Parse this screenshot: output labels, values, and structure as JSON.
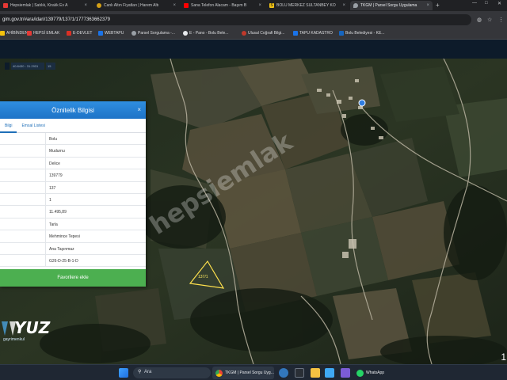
{
  "browser": {
    "tabs": [
      {
        "label": "Hepsiemlak | Satılık, Kiralık Ev A",
        "icon_color": "#e53935"
      },
      {
        "label": "Canlı Altın Fiyatları | Harem Altı",
        "icon_color": "#d4a017"
      },
      {
        "label": "Sana Telefon Alacam - Başım B",
        "icon_color": "#ff0000"
      },
      {
        "label": "BOLU MERKEZ SULTANBEY KÖ",
        "icon_color": "#f2c318",
        "icon_text": "S"
      },
      {
        "label": "TKGM | Parsel Sorgu Uygulama",
        "icon_color": "#9aa0a6"
      }
    ],
    "close_glyph": "×",
    "new_tab": "+",
    "url": "gim.gov.tr/#ara/idari/139779/137/1/1777363662379",
    "bookmarks": [
      {
        "label": "AHİBİNDEN",
        "icon_color": "#f4c20d"
      },
      {
        "label": "HEPSİ EMLAK",
        "icon_color": "#e53935"
      },
      {
        "label": "E-DEVLET",
        "icon_color": "#d93025"
      },
      {
        "label": "WEBTAPU",
        "icon_color": "#1a73e8"
      },
      {
        "label": "Parsel Sorgulama -...",
        "icon_color": "#9aa0a6"
      },
      {
        "label": "E - Pano - Bolu Bele...",
        "icon_color": "#e8eaed"
      },
      {
        "label": "Ulusal Coğrafi Bilgi...",
        "icon_color": "#c0392b"
      },
      {
        "label": "TAPU KADASTRO",
        "icon_color": "#1a73e8"
      },
      {
        "label": "Bolu Belediyesi - KE...",
        "icon_color": "#1565c0"
      }
    ]
  },
  "map_info": {
    "coords": [
      "40.8430 : 31.2931",
      "15"
    ]
  },
  "attribute_panel": {
    "title": "Öznitelik Bilgisi",
    "close": "×",
    "tabs": [
      "Bilgi",
      "Emsal Listesi"
    ],
    "rows": [
      "Bolu",
      "Mudurnu",
      "Delice",
      "139779",
      "137",
      "1",
      "11.495,89",
      "Tarla",
      "Mehmince Tepesi",
      "Ana Taşınmaz",
      "G26-D-25-B-1-D"
    ],
    "favorite_button": "Favorilere ekle"
  },
  "map_labels": {
    "parcel": "137/1",
    "watermark": "hepsiemlak",
    "logo_text": "YUZ",
    "logo_sub": "gayrimenkul",
    "side_number": "1"
  },
  "taskbar": {
    "search_placeholder": "Ara",
    "active_app": "TKGM | Parsel Sorgu Uyg...",
    "whatsapp": "WhatsApp"
  }
}
